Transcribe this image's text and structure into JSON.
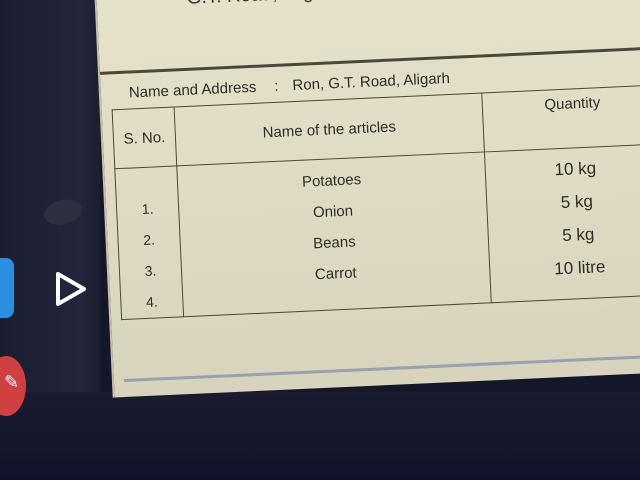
{
  "document": {
    "heading": "G.T. Road, Aligarh",
    "name_address_label": "Name and Address",
    "name_address_sep": ":",
    "name_address_value": "Ron, G.T. Road, Aligarh",
    "table": {
      "headers": {
        "sno": "S. No.",
        "name": "Name of the articles",
        "qty": "Quantity"
      },
      "serial_numbers": [
        "1.",
        "2.",
        "3.",
        "4."
      ],
      "articles": [
        "Potatoes",
        "Onion",
        "Beans",
        "Carrot"
      ],
      "quantities": [
        "10 kg",
        "5 kg",
        "5 kg",
        "10 litre"
      ]
    }
  },
  "device_ui": {
    "icons": [
      "menu-button-icon",
      "tab-indicator-icon",
      "play-icon",
      "edit-fab-icon"
    ],
    "colors": {
      "tab": "#2a8fe0",
      "fab": "#d04040",
      "paper": "#e6e2cc",
      "ink": "#2e2d22"
    }
  }
}
